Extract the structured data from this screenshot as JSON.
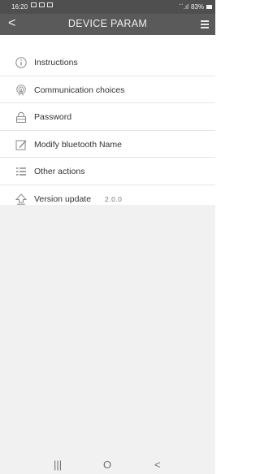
{
  "status_bar": {
    "time": "16:20",
    "signal": "´´.ıl",
    "battery": "83%"
  },
  "header": {
    "back": "<",
    "title": "DEVICE PARAM"
  },
  "menu": {
    "items": [
      {
        "label": "Instructions",
        "icon": "info-icon"
      },
      {
        "label": "Communication choices",
        "icon": "antenna-icon"
      },
      {
        "label": "Password",
        "icon": "lock-icon"
      },
      {
        "label": "Modify bluetooth Name",
        "icon": "edit-icon"
      },
      {
        "label": "Other actions",
        "icon": "list-icon"
      },
      {
        "label": "Version update",
        "icon": "upload-icon",
        "value": "2.0.0"
      }
    ]
  },
  "nav_bar": {
    "recent": "|||",
    "home": "O",
    "back": "<"
  },
  "colors": {
    "header_bg": "#5a5a5a",
    "status_bg": "#4f4f4f",
    "page_bg": "#f1f1f1"
  }
}
